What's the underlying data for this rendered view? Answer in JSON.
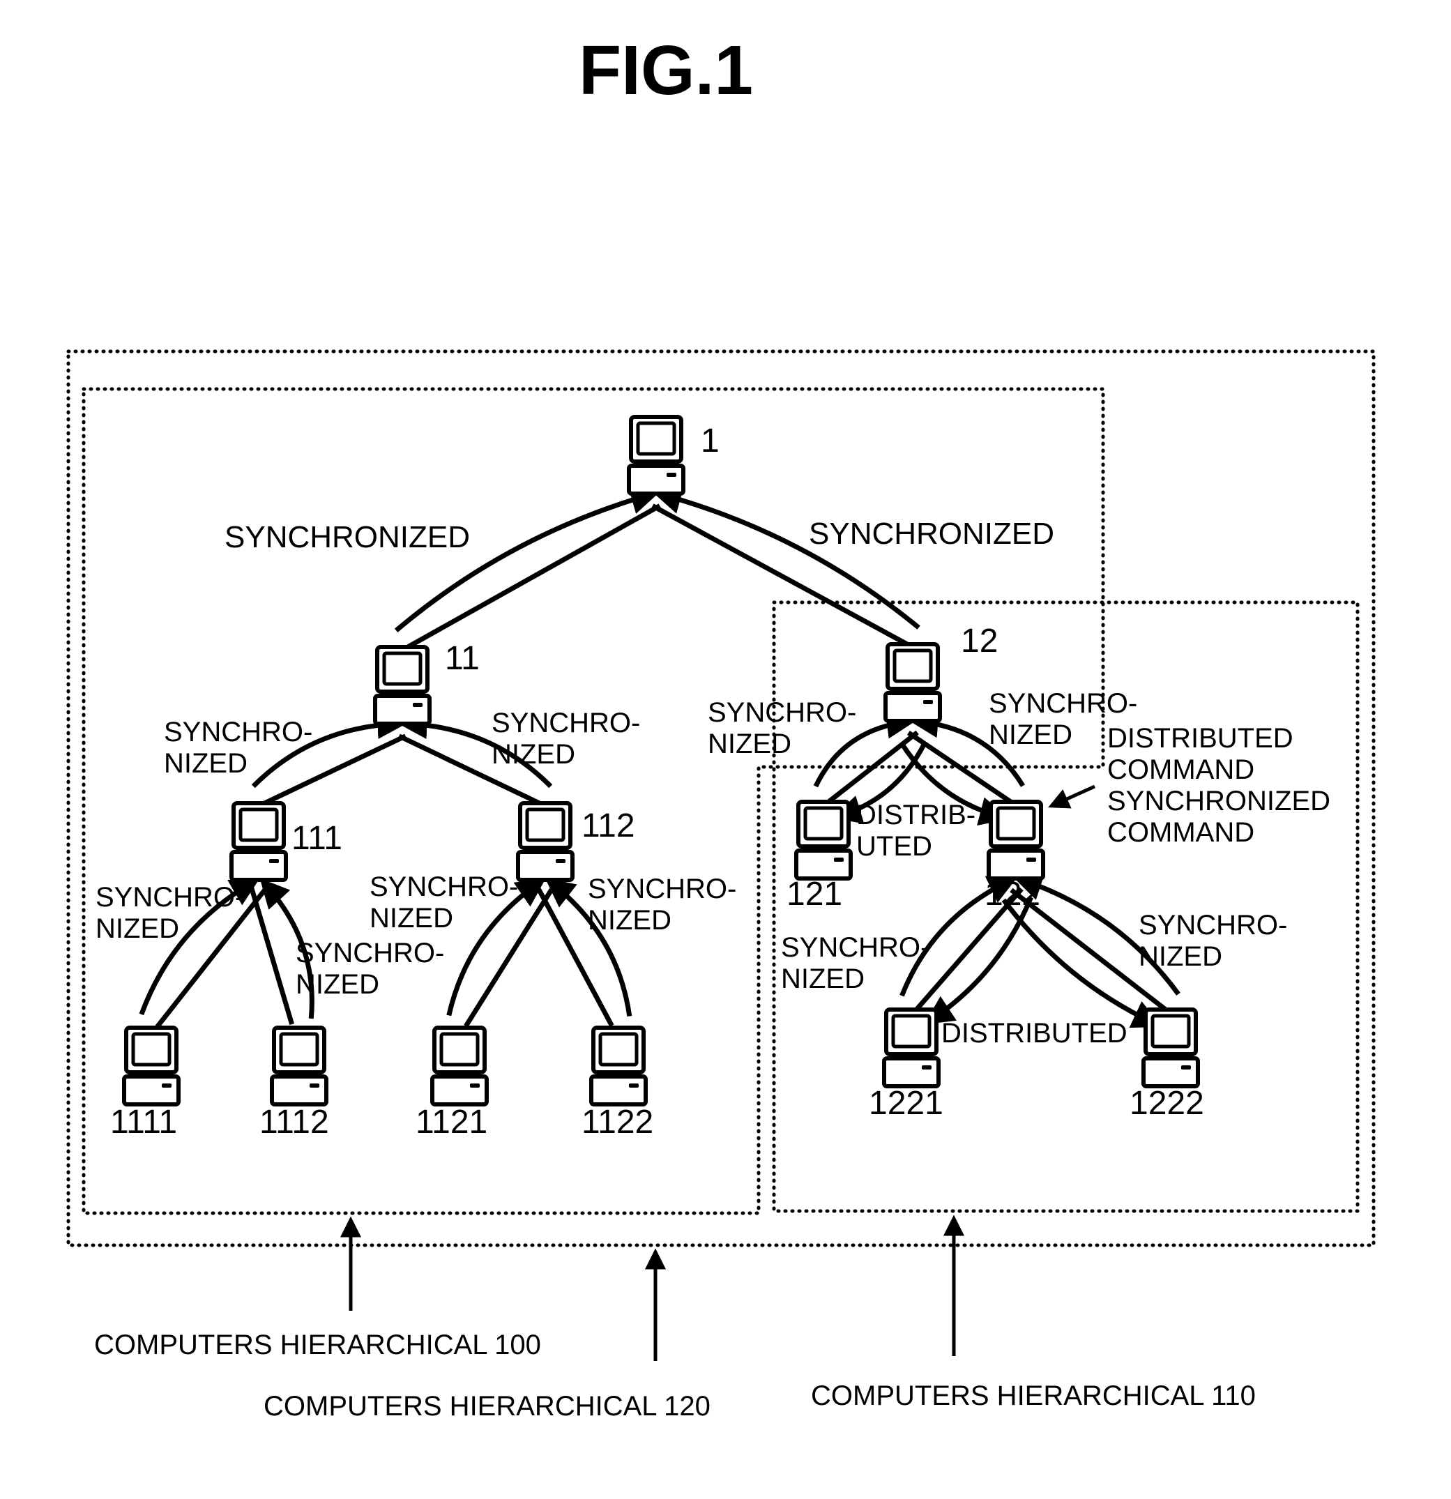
{
  "figure": {
    "title": "FIG.1"
  },
  "nodes": [
    {
      "id": "1",
      "label": "1"
    },
    {
      "id": "11",
      "label": "11"
    },
    {
      "id": "12",
      "label": "12"
    },
    {
      "id": "111",
      "label": "111"
    },
    {
      "id": "112",
      "label": "112"
    },
    {
      "id": "121",
      "label": "121"
    },
    {
      "id": "122",
      "label": "122"
    },
    {
      "id": "1111",
      "label": "1111"
    },
    {
      "id": "1112",
      "label": "1112"
    },
    {
      "id": "1121",
      "label": "1121"
    },
    {
      "id": "1122",
      "label": "1122"
    },
    {
      "id": "1221",
      "label": "1221"
    },
    {
      "id": "1222",
      "label": "1222"
    }
  ],
  "edges": [
    {
      "from": "11",
      "to": "1",
      "label": [
        "SYNCHRONIZED"
      ],
      "kind": "synchronized"
    },
    {
      "from": "12",
      "to": "1",
      "label": [
        "SYNCHRONIZED"
      ],
      "kind": "synchronized"
    },
    {
      "from": "111",
      "to": "11",
      "label": [
        "SYNCHRO-",
        "NIZED"
      ],
      "kind": "synchronized"
    },
    {
      "from": "112",
      "to": "11",
      "label": [
        "SYNCHRO-",
        "NIZED"
      ],
      "kind": "synchronized"
    },
    {
      "from": "121",
      "to": "12",
      "label": [
        "SYNCHRO-",
        "NIZED"
      ],
      "kind": "synchronized+distributed"
    },
    {
      "from": "122",
      "to": "12",
      "label": [
        "SYNCHRO-",
        "NIZED"
      ],
      "kind": "synchronized+distributed"
    },
    {
      "from": "1111",
      "to": "111",
      "label": [
        "SYNCHRO-",
        "NIZED"
      ],
      "kind": "synchronized"
    },
    {
      "from": "1112",
      "to": "111",
      "label": [
        "SYNCHRO-",
        "NIZED"
      ],
      "kind": "synchronized"
    },
    {
      "from": "1121",
      "to": "112",
      "label": [
        "SYNCHRO-",
        "NIZED"
      ],
      "kind": "synchronized"
    },
    {
      "from": "1122",
      "to": "112",
      "label": [
        "SYNCHRO-",
        "NIZED"
      ],
      "kind": "synchronized"
    },
    {
      "from": "1221",
      "to": "122",
      "label": [
        "SYNCHRO-",
        "NIZED"
      ],
      "kind": "synchronized+distributed"
    },
    {
      "from": "1222",
      "to": "122",
      "label": [
        "SYNCHRO-",
        "NIZED"
      ],
      "kind": "synchronized+distributed"
    }
  ],
  "edge_labels": {
    "distributed_121_122": [
      "DISTRIB-",
      "UTED"
    ],
    "distributed_1221_1222": [
      "DISTRIBUTED"
    ]
  },
  "annotation_122": [
    "DISTRIBUTED",
    "COMMAND",
    "SYNCHRONIZED",
    "COMMAND"
  ],
  "groups": [
    {
      "id": "100",
      "caption": "COMPUTERS HIERARCHICAL 100"
    },
    {
      "id": "120",
      "caption": "COMPUTERS HIERARCHICAL 120"
    },
    {
      "id": "110",
      "caption": "COMPUTERS HIERARCHICAL 110"
    }
  ]
}
